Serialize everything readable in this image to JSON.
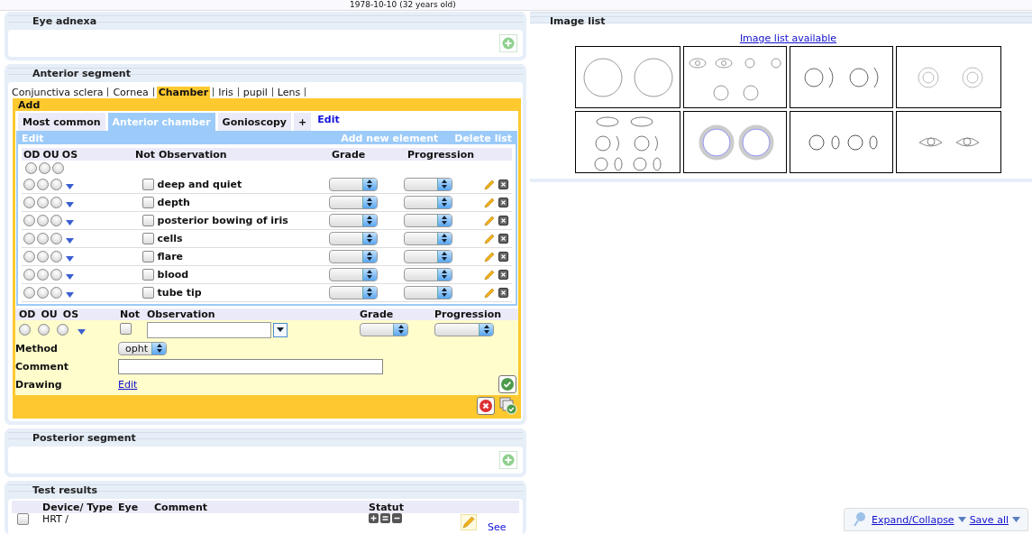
{
  "patient_line": "1978-10-10 (32 years old)",
  "eye_adnexa": {
    "title": "Eye adnexa"
  },
  "anterior_segment": {
    "title": "Anterior segment",
    "nav": [
      {
        "label": "Conjunctiva sclera",
        "selected": false
      },
      {
        "label": "Cornea",
        "selected": false
      },
      {
        "label": "Chamber",
        "selected": true
      },
      {
        "label": "Iris",
        "selected": false
      },
      {
        "label": "pupil",
        "selected": false
      },
      {
        "label": "Lens",
        "selected": false
      }
    ],
    "add_bar": "Add",
    "tabs": [
      {
        "label": "Most common",
        "selected": false
      },
      {
        "label": "Anterior chamber",
        "selected": true
      },
      {
        "label": "Gonioscopy",
        "selected": false
      },
      {
        "label": "+",
        "selected": false
      }
    ],
    "tabs_edit": "Edit",
    "list_bar": {
      "edit": "Edit",
      "add": "Add new element",
      "delete": "Delete list"
    },
    "columns": [
      "OD",
      "OU",
      "OS",
      "Not",
      "Observation",
      "Grade",
      "Progression"
    ],
    "header_radios": [
      {
        "selected": false
      },
      {
        "selected": false
      },
      {
        "selected": false
      }
    ],
    "rows": [
      {
        "observation": "deep and quiet",
        "not": false,
        "eyes": [
          {
            "selected": false
          },
          {
            "selected": false
          },
          {
            "selected": false
          }
        ]
      },
      {
        "observation": "depth",
        "not": false,
        "eyes": [
          {
            "selected": false
          },
          {
            "selected": false
          },
          {
            "selected": false
          }
        ]
      },
      {
        "observation": "posterior bowing of iris",
        "not": false,
        "eyes": [
          {
            "selected": false
          },
          {
            "selected": false
          },
          {
            "selected": false
          }
        ]
      },
      {
        "observation": "cells",
        "not": false,
        "eyes": [
          {
            "selected": false
          },
          {
            "selected": false
          },
          {
            "selected": false
          }
        ]
      },
      {
        "observation": "flare",
        "not": false,
        "eyes": [
          {
            "selected": false
          },
          {
            "selected": false
          },
          {
            "selected": false
          }
        ]
      },
      {
        "observation": "blood",
        "not": false,
        "eyes": [
          {
            "selected": false
          },
          {
            "selected": false
          },
          {
            "selected": false
          }
        ]
      },
      {
        "observation": "tube tip",
        "not": false,
        "eyes": [
          {
            "selected": false
          },
          {
            "selected": false
          },
          {
            "selected": false
          }
        ]
      }
    ],
    "form": {
      "columns": [
        "OD",
        "OU",
        "OS",
        "Not",
        "Observation",
        "Grade",
        "Progression"
      ],
      "eyes": [
        {
          "selected": false
        },
        {
          "selected": false
        },
        {
          "selected": false
        }
      ],
      "not": false,
      "method_label": "Method",
      "method_value": "opht",
      "comment_label": "Comment",
      "drawing_label": "Drawing",
      "drawing_link": "Edit"
    }
  },
  "posterior_segment": {
    "title": "Posterior segment"
  },
  "test_results": {
    "title": "Test results",
    "columns": [
      "Device/ Type",
      "Eye",
      "Comment",
      "Statut"
    ],
    "rows": [
      {
        "device": "HRT /",
        "checked": false,
        "link": "See"
      }
    ]
  },
  "image_list": {
    "title": "Image list",
    "link": "Image list available",
    "thumbnails": [
      {
        "kind": "two-circles"
      },
      {
        "kind": "eye-symbols"
      },
      {
        "kind": "circle-arcs"
      },
      {
        "kind": "grids"
      },
      {
        "kind": "eye-lens-set"
      },
      {
        "kind": "rings"
      },
      {
        "kind": "circle-ovals"
      },
      {
        "kind": "eyes"
      }
    ]
  },
  "footer": {
    "expand": "Expand/Collapse",
    "save": "Save all"
  }
}
